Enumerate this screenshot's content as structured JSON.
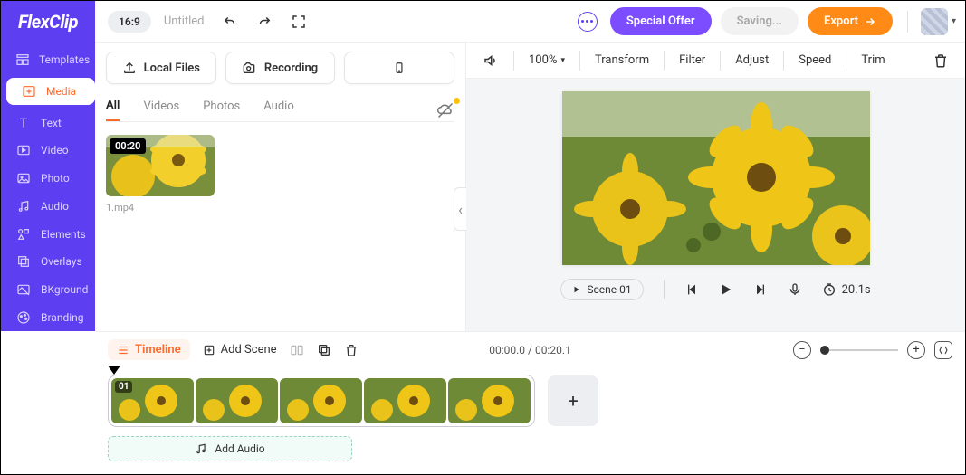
{
  "top": {
    "logo": "FlexClip",
    "aspect": "16:9",
    "title": "Untitled",
    "special_offer": "Special Offer",
    "saving": "Saving...",
    "export": "Export"
  },
  "sidebar": {
    "items": [
      {
        "label": "Templates"
      },
      {
        "label": "Media"
      },
      {
        "label": "Text"
      },
      {
        "label": "Video"
      },
      {
        "label": "Photo"
      },
      {
        "label": "Audio"
      },
      {
        "label": "Elements"
      },
      {
        "label": "Overlays"
      },
      {
        "label": "BKground"
      },
      {
        "label": "Branding"
      }
    ],
    "active": 1
  },
  "media_panel": {
    "local_files": "Local Files",
    "recording": "Recording",
    "tabs": [
      "All",
      "Videos",
      "Photos",
      "Audio"
    ],
    "active_tab": 0,
    "items": [
      {
        "badge": "00:20",
        "name": "1.mp4"
      }
    ]
  },
  "preview_toolbar": {
    "zoom": "100%",
    "items": [
      "Transform",
      "Filter",
      "Adjust",
      "Speed",
      "Trim"
    ]
  },
  "preview": {
    "scene_label": "Scene 01",
    "duration": "20.1s"
  },
  "timeline": {
    "label": "Timeline",
    "add_scene": "Add Scene",
    "time_display": "00:00.0 / 00:20.1",
    "scene_number": "01",
    "add_audio": "Add Audio"
  }
}
